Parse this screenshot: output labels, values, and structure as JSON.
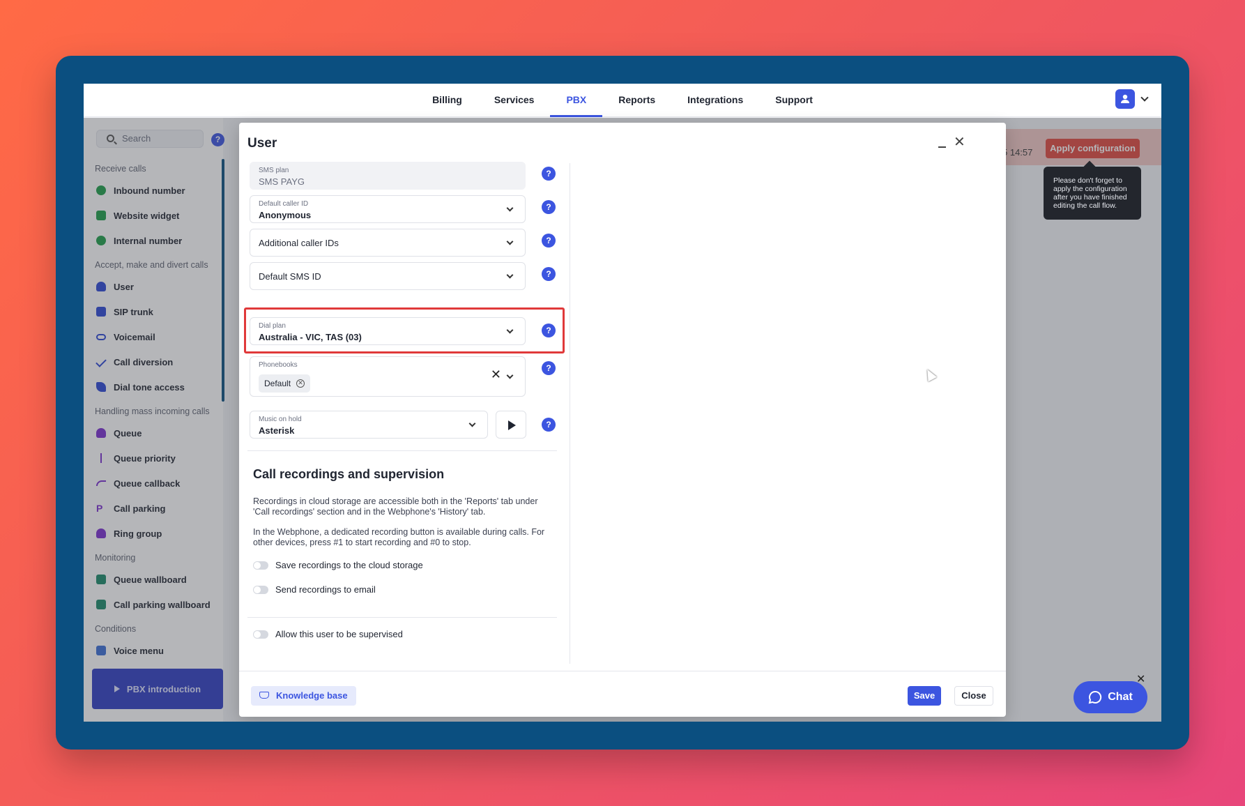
{
  "nav": {
    "tabs": [
      "Billing",
      "Services",
      "PBX",
      "Reports",
      "Integrations",
      "Support"
    ],
    "active_tab": "PBX"
  },
  "sidebar": {
    "search_placeholder": "Search",
    "help": "?",
    "sections": [
      {
        "title": "Receive calls",
        "items": [
          "Inbound number",
          "Website widget",
          "Internal number"
        ]
      },
      {
        "title": "Accept, make and divert calls",
        "items": [
          "User",
          "SIP trunk",
          "Voicemail",
          "Call diversion",
          "Dial tone access"
        ]
      },
      {
        "title": "Handling mass incoming calls",
        "items": [
          "Queue",
          "Queue priority",
          "Queue callback",
          "Call parking",
          "Ring group"
        ]
      },
      {
        "title": "Monitoring",
        "items": [
          "Queue wallboard",
          "Call parking wallboard"
        ]
      },
      {
        "title": "Conditions",
        "items": [
          "Voice menu"
        ]
      }
    ],
    "intro_button": "PBX introduction"
  },
  "background": {
    "time": "5 14:57",
    "apply_button": "Apply configuration",
    "tooltip": "Please don't forget to apply the configuration after you have finished editing the call flow.",
    "chat_button": "Chat"
  },
  "modal": {
    "title": "User",
    "sms_plan": {
      "label": "SMS plan",
      "value": "SMS PAYG"
    },
    "default_caller_id": {
      "label": "Default caller ID",
      "value": "Anonymous"
    },
    "additional_caller_ids": {
      "label": "Additional caller IDs"
    },
    "default_sms_id": {
      "label": "Default SMS ID"
    },
    "dial_plan": {
      "label": "Dial plan",
      "value": "Australia - VIC, TAS (03)"
    },
    "phonebooks": {
      "label": "Phonebooks",
      "chip": "Default"
    },
    "music_on_hold": {
      "label": "Music on hold",
      "value": "Asterisk"
    },
    "section_title": "Call recordings and supervision",
    "para1": "Recordings in cloud storage are accessible both in the 'Reports' tab under 'Call recordings' section and in the Webphone's 'History' tab.",
    "para2": "In the Webphone, a dedicated recording button is available during calls. For other devices, press #1 to start recording and #0 to stop.",
    "toggles": {
      "save_cloud": "Save recordings to the cloud storage",
      "send_email": "Send recordings to email",
      "supervised": "Allow this user to be supervised"
    },
    "knowledge_base": "Knowledge base",
    "save": "Save",
    "close": "Close"
  }
}
